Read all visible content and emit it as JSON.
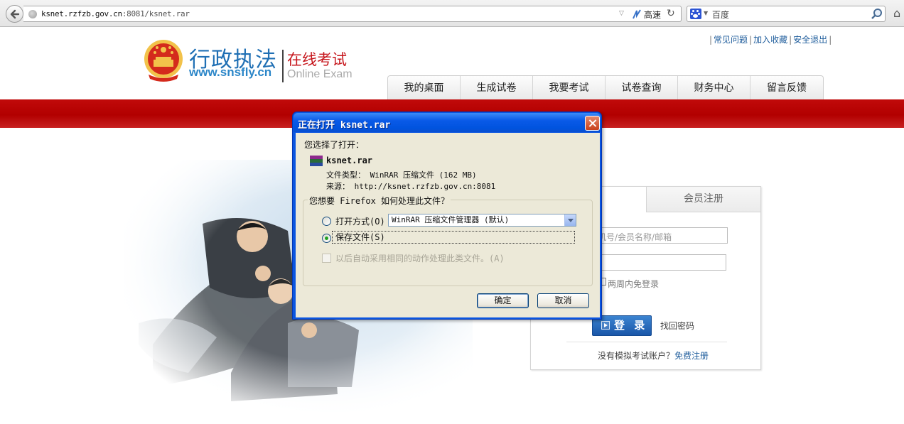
{
  "browser": {
    "url_host": "ksnet.rzfzb.gov.cn",
    "url_path": ":8081/ksnet.rar",
    "speed_label": "高速",
    "search_engine": "百度"
  },
  "site": {
    "logo_title": "行政执法",
    "logo_url": "www.snsfly.cn",
    "logo_subtitle": "在线考试",
    "logo_subtitle_en": "Online Exam",
    "top_links": [
      "常见问题",
      "加入收藏",
      "安全退出"
    ],
    "nav": [
      "我的桌面",
      "生成试卷",
      "我要考试",
      "试卷查询",
      "财务中心",
      "留言反馈"
    ],
    "brand_red": "#b20000"
  },
  "login": {
    "tab_register": "会员注册",
    "username_placeholder": "机号/会员名称/邮箱",
    "remember_label": "两周内免登录",
    "login_button": "登 录",
    "forgot_password": "找回密码",
    "no_account_text": "没有模拟考试账户？",
    "register_link": "免费注册"
  },
  "dialog": {
    "title": "正在打开 ksnet.rar",
    "chose_label": "您选择了打开：",
    "filename": "ksnet.rar",
    "file_type": "文件类型： WinRAR 压缩文件 (162 MB)",
    "source": "来源： http://ksnet.rzfzb.gov.cn:8081",
    "question": "您想要 Firefox 如何处理此文件？",
    "open_with_label": "打开方式(O)",
    "open_with_value": "WinRAR 压缩文件管理器 (默认)",
    "save_label": "保存文件(S)",
    "auto_label": "以后自动采用相同的动作处理此类文件。(A)",
    "ok": "确定",
    "cancel": "取消",
    "selected_option": "save",
    "title_color": "#0a55e0"
  }
}
